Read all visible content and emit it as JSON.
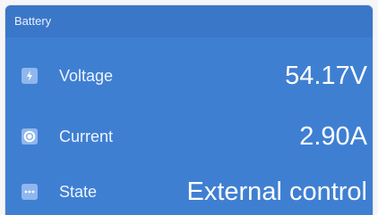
{
  "header": {
    "title": "Battery"
  },
  "rows": [
    {
      "label": "Voltage",
      "value": "54.17V",
      "icon": "lightning-icon"
    },
    {
      "label": "Current",
      "value": "2.90A",
      "icon": "current-icon"
    },
    {
      "label": "State",
      "value": "External control",
      "icon": "ellipsis-icon"
    }
  ],
  "colors": {
    "panel": "#3f7fd2",
    "header": "#3a77c8",
    "icon_bg": "#8fb7ee"
  }
}
